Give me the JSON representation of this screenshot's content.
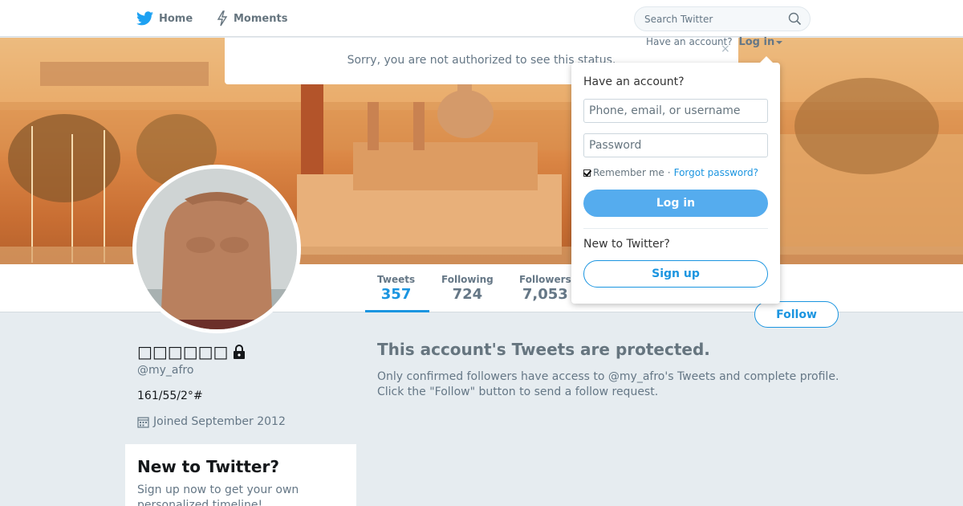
{
  "nav": {
    "home_label": "Home",
    "moments_label": "Moments",
    "search_placeholder": "Search Twitter"
  },
  "status_message": {
    "text": "Sorry, you are not authorized to see this status.",
    "close_glyph": "×"
  },
  "login_prompt": {
    "question": "Have an account?",
    "link_label": "Log in"
  },
  "login_dropdown": {
    "heading": "Have an account?",
    "username_placeholder": "Phone, email, or username",
    "password_placeholder": "Password",
    "remember_label": "Remember me",
    "separator": "·",
    "forgot_label": "Forgot password?",
    "remember_checked": true,
    "login_button": "Log in",
    "new_heading": "New to Twitter?",
    "signup_button": "Sign up"
  },
  "stats": [
    {
      "label": "Tweets",
      "value": "357"
    },
    {
      "label": "Following",
      "value": "724"
    },
    {
      "label": "Followers",
      "value": "7,053"
    }
  ],
  "follow_button": "Follow",
  "profile": {
    "name": "□□□□□□",
    "handle": "@my_afro",
    "bio": "161/55/2°#",
    "joined": "Joined September 2012"
  },
  "signup_card": {
    "title": "New to Twitter?",
    "text": "Sign up now to get your own personalized timeline!"
  },
  "protected": {
    "title": "This account's Tweets are protected.",
    "text": "Only confirmed followers have access to @my_afro's Tweets and complete profile. Click the \"Follow\" button to send a follow request."
  },
  "colors": {
    "accent": "#1b95e0",
    "login_button": "#55acee",
    "page_bg": "#e6ecf0",
    "muted_text": "#657786"
  },
  "icons": [
    "twitter-bird-icon",
    "lightning-icon",
    "search-icon",
    "close-icon",
    "caret-down-icon",
    "lock-icon",
    "calendar-icon"
  ]
}
